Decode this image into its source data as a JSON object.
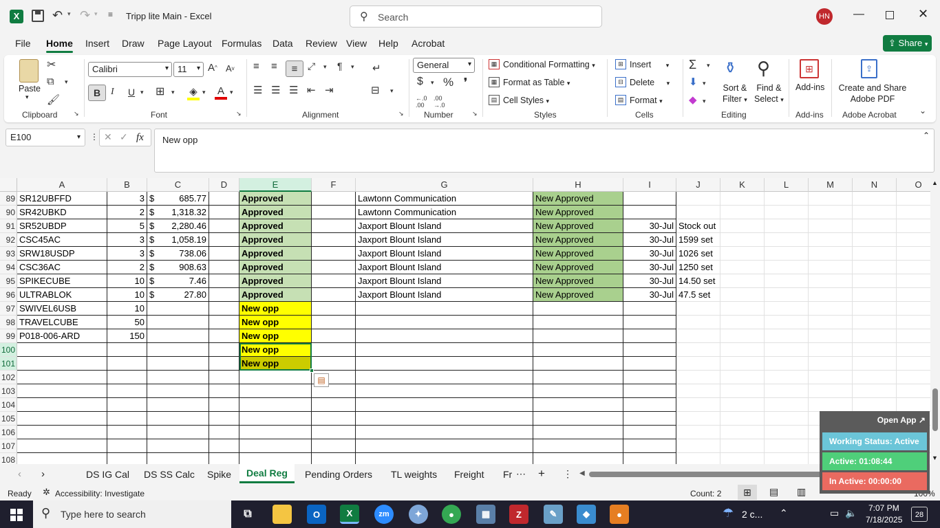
{
  "titlebar": {
    "file_name": "Tripp lite Main",
    "separator": "-",
    "app_name": "Excel",
    "search_placeholder": "Search",
    "user_initials": "HN"
  },
  "ribbon_tabs": [
    "File",
    "Home",
    "Insert",
    "Draw",
    "Page Layout",
    "Formulas",
    "Data",
    "Review",
    "View",
    "Help",
    "Acrobat"
  ],
  "share_label": "Share",
  "ribbon": {
    "paste": "Paste",
    "font_name": "Calibri",
    "font_size": "11",
    "bold": "B",
    "italic": "I",
    "underline": "U",
    "number_format": "General",
    "conditional_formatting": "Conditional Formatting",
    "format_as_table": "Format as Table",
    "cell_styles": "Cell Styles",
    "insert": "Insert",
    "delete": "Delete",
    "format": "Format",
    "sort_filter_1": "Sort &",
    "sort_filter_2": "Filter",
    "find_select_1": "Find &",
    "find_select_2": "Select",
    "add_ins": "Add-ins",
    "create_share_1": "Create and Share",
    "create_share_2": "Adobe PDF",
    "groups": {
      "clipboard": "Clipboard",
      "font": "Font",
      "alignment": "Alignment",
      "number": "Number",
      "styles": "Styles",
      "cells": "Cells",
      "editing": "Editing",
      "addins": "Add-ins",
      "acrobat": "Adobe Acrobat"
    }
  },
  "formula_bar": {
    "name_box": "E100",
    "fx": "fx",
    "content": "New opp"
  },
  "columns": [
    "A",
    "B",
    "C",
    "D",
    "E",
    "F",
    "G",
    "H",
    "I",
    "J",
    "K",
    "L",
    "M",
    "N",
    "O"
  ],
  "rows": [
    {
      "num": "89",
      "a": "SR12UBFFD",
      "b": "3",
      "c_sym": "$",
      "c": "685.77",
      "e": "Approved",
      "g": "Lawtonn Communication",
      "h": "New Approved",
      "i": "",
      "j": ""
    },
    {
      "num": "90",
      "a": "SR42UBKD",
      "b": "2",
      "c_sym": "$",
      "c": "1,318.32",
      "e": "Approved",
      "g": "Lawtonn Communication",
      "h": "New Approved",
      "i": "",
      "j": ""
    },
    {
      "num": "91",
      "a": "SR52UBDP",
      "b": "5",
      "c_sym": "$",
      "c": "2,280.46",
      "e": "Approved",
      "g": "Jaxport Blount Island",
      "h": "New Approved",
      "i": "30-Jul",
      "j": "Stock out"
    },
    {
      "num": "92",
      "a": "CSC45AC",
      "b": "3",
      "c_sym": "$",
      "c": "1,058.19",
      "e": "Approved",
      "g": "Jaxport Blount Island",
      "h": "New Approved",
      "i": "30-Jul",
      "j": "1599 set"
    },
    {
      "num": "93",
      "a": "SRW18USDP",
      "b": "3",
      "c_sym": "$",
      "c": "738.06",
      "e": "Approved",
      "g": "Jaxport Blount Island",
      "h": "New Approved",
      "i": "30-Jul",
      "j": "1026 set"
    },
    {
      "num": "94",
      "a": "CSC36AC",
      "b": "2",
      "c_sym": "$",
      "c": "908.63",
      "e": "Approved",
      "g": "Jaxport Blount Island",
      "h": "New Approved",
      "i": "30-Jul",
      "j": "1250 set"
    },
    {
      "num": "95",
      "a": "SPIKECUBE",
      "b": "10",
      "c_sym": "$",
      "c": "7.46",
      "e": "Approved",
      "g": "Jaxport Blount Island",
      "h": "New Approved",
      "i": "30-Jul",
      "j": "14.50 set"
    },
    {
      "num": "96",
      "a": "ULTRABLOK",
      "b": "10",
      "c_sym": "$",
      "c": "27.80",
      "e": "Approved",
      "g": "Jaxport Blount Island",
      "h": "New Approved",
      "i": "30-Jul",
      "j": "47.5  set"
    },
    {
      "num": "97",
      "a": "SWIVEL6USB",
      "b": "10",
      "c_sym": "",
      "c": "",
      "e": "New opp",
      "g": "",
      "h": "",
      "i": "",
      "j": ""
    },
    {
      "num": "98",
      "a": "TRAVELCUBE",
      "b": "50",
      "c_sym": "",
      "c": "",
      "e": "New opp",
      "g": "",
      "h": "",
      "i": "",
      "j": ""
    },
    {
      "num": "99",
      "a": "P018-006-ARD",
      "b": "150",
      "c_sym": "",
      "c": "",
      "e": "New opp",
      "g": "",
      "h": "",
      "i": "",
      "j": ""
    },
    {
      "num": "100",
      "a": "",
      "b": "",
      "c_sym": "",
      "c": "",
      "e": "New opp",
      "g": "",
      "h": "",
      "i": "",
      "j": ""
    },
    {
      "num": "101",
      "a": "",
      "b": "",
      "c_sym": "",
      "c": "",
      "e": "New opp",
      "g": "",
      "h": "",
      "i": "",
      "j": ""
    },
    {
      "num": "102",
      "a": "",
      "b": "",
      "c_sym": "",
      "c": "",
      "e": "",
      "g": "",
      "h": "",
      "i": "",
      "j": ""
    },
    {
      "num": "103",
      "a": "",
      "b": "",
      "c_sym": "",
      "c": "",
      "e": "",
      "g": "",
      "h": "",
      "i": "",
      "j": ""
    },
    {
      "num": "104",
      "a": "",
      "b": "",
      "c_sym": "",
      "c": "",
      "e": "",
      "g": "",
      "h": "",
      "i": "",
      "j": ""
    },
    {
      "num": "105",
      "a": "",
      "b": "",
      "c_sym": "",
      "c": "",
      "e": "",
      "g": "",
      "h": "",
      "i": "",
      "j": ""
    },
    {
      "num": "106",
      "a": "",
      "b": "",
      "c_sym": "",
      "c": "",
      "e": "",
      "g": "",
      "h": "",
      "i": "",
      "j": ""
    },
    {
      "num": "107",
      "a": "",
      "b": "",
      "c_sym": "",
      "c": "",
      "e": "",
      "g": "",
      "h": "",
      "i": "",
      "j": ""
    },
    {
      "num": "108",
      "a": "",
      "b": "",
      "c_sym": "",
      "c": "",
      "e": "",
      "g": "",
      "h": "",
      "i": "",
      "j": ""
    }
  ],
  "colors": {
    "approved_fill": "#c6e0b4",
    "new_approved_fill": "#a9d08e",
    "new_opp_fill": "#ffff00",
    "selected_fill": "#cccc00",
    "excel_green": "#107c41"
  },
  "sheet_tabs": [
    "DS IG Cal",
    "DS SS Calc",
    "Spike",
    "Deal Reg",
    "Pending Orders",
    "TL weights",
    "Freight",
    "Fr"
  ],
  "active_sheet": "Deal Reg",
  "status": {
    "ready": "Ready",
    "accessibility": "Accessibility: Investigate",
    "count": "Count: 2",
    "zoom": "100%"
  },
  "widget": {
    "open_app": "Open App ↗",
    "working_status": "Working Status: Active",
    "active": "Active: 01:08:44",
    "inactive": "In Active: 00:00:00"
  },
  "taskbar": {
    "search_placeholder": "Type here to search",
    "weather": "2 c...",
    "time": "7:07 PM",
    "date": "7/18/2025",
    "notifications": "28"
  }
}
